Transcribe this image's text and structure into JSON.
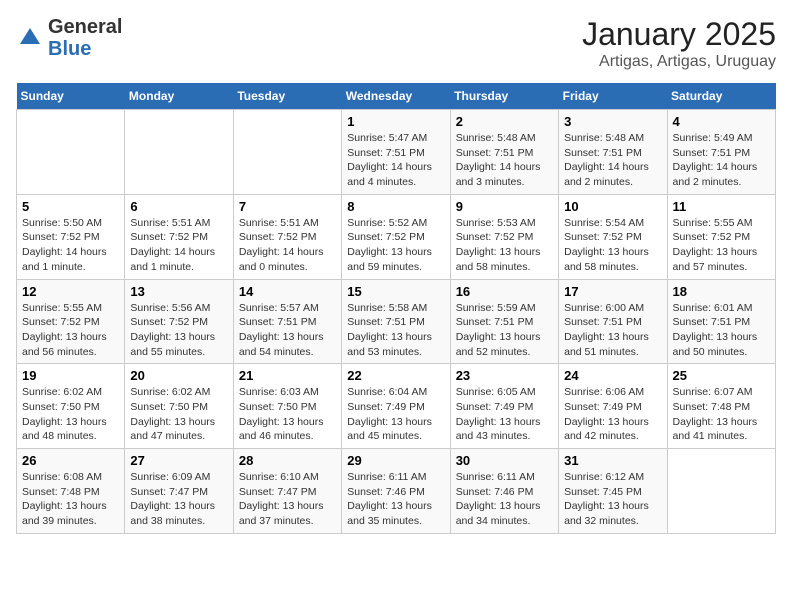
{
  "logo": {
    "general": "General",
    "blue": "Blue"
  },
  "title": "January 2025",
  "subtitle": "Artigas, Artigas, Uruguay",
  "days_of_week": [
    "Sunday",
    "Monday",
    "Tuesday",
    "Wednesday",
    "Thursday",
    "Friday",
    "Saturday"
  ],
  "weeks": [
    [
      {
        "day": "",
        "info": ""
      },
      {
        "day": "",
        "info": ""
      },
      {
        "day": "",
        "info": ""
      },
      {
        "day": "1",
        "info": "Sunrise: 5:47 AM\nSunset: 7:51 PM\nDaylight: 14 hours\nand 4 minutes."
      },
      {
        "day": "2",
        "info": "Sunrise: 5:48 AM\nSunset: 7:51 PM\nDaylight: 14 hours\nand 3 minutes."
      },
      {
        "day": "3",
        "info": "Sunrise: 5:48 AM\nSunset: 7:51 PM\nDaylight: 14 hours\nand 2 minutes."
      },
      {
        "day": "4",
        "info": "Sunrise: 5:49 AM\nSunset: 7:51 PM\nDaylight: 14 hours\nand 2 minutes."
      }
    ],
    [
      {
        "day": "5",
        "info": "Sunrise: 5:50 AM\nSunset: 7:52 PM\nDaylight: 14 hours\nand 1 minute."
      },
      {
        "day": "6",
        "info": "Sunrise: 5:51 AM\nSunset: 7:52 PM\nDaylight: 14 hours\nand 1 minute."
      },
      {
        "day": "7",
        "info": "Sunrise: 5:51 AM\nSunset: 7:52 PM\nDaylight: 14 hours\nand 0 minutes."
      },
      {
        "day": "8",
        "info": "Sunrise: 5:52 AM\nSunset: 7:52 PM\nDaylight: 13 hours\nand 59 minutes."
      },
      {
        "day": "9",
        "info": "Sunrise: 5:53 AM\nSunset: 7:52 PM\nDaylight: 13 hours\nand 58 minutes."
      },
      {
        "day": "10",
        "info": "Sunrise: 5:54 AM\nSunset: 7:52 PM\nDaylight: 13 hours\nand 58 minutes."
      },
      {
        "day": "11",
        "info": "Sunrise: 5:55 AM\nSunset: 7:52 PM\nDaylight: 13 hours\nand 57 minutes."
      }
    ],
    [
      {
        "day": "12",
        "info": "Sunrise: 5:55 AM\nSunset: 7:52 PM\nDaylight: 13 hours\nand 56 minutes."
      },
      {
        "day": "13",
        "info": "Sunrise: 5:56 AM\nSunset: 7:52 PM\nDaylight: 13 hours\nand 55 minutes."
      },
      {
        "day": "14",
        "info": "Sunrise: 5:57 AM\nSunset: 7:51 PM\nDaylight: 13 hours\nand 54 minutes."
      },
      {
        "day": "15",
        "info": "Sunrise: 5:58 AM\nSunset: 7:51 PM\nDaylight: 13 hours\nand 53 minutes."
      },
      {
        "day": "16",
        "info": "Sunrise: 5:59 AM\nSunset: 7:51 PM\nDaylight: 13 hours\nand 52 minutes."
      },
      {
        "day": "17",
        "info": "Sunrise: 6:00 AM\nSunset: 7:51 PM\nDaylight: 13 hours\nand 51 minutes."
      },
      {
        "day": "18",
        "info": "Sunrise: 6:01 AM\nSunset: 7:51 PM\nDaylight: 13 hours\nand 50 minutes."
      }
    ],
    [
      {
        "day": "19",
        "info": "Sunrise: 6:02 AM\nSunset: 7:50 PM\nDaylight: 13 hours\nand 48 minutes."
      },
      {
        "day": "20",
        "info": "Sunrise: 6:02 AM\nSunset: 7:50 PM\nDaylight: 13 hours\nand 47 minutes."
      },
      {
        "day": "21",
        "info": "Sunrise: 6:03 AM\nSunset: 7:50 PM\nDaylight: 13 hours\nand 46 minutes."
      },
      {
        "day": "22",
        "info": "Sunrise: 6:04 AM\nSunset: 7:49 PM\nDaylight: 13 hours\nand 45 minutes."
      },
      {
        "day": "23",
        "info": "Sunrise: 6:05 AM\nSunset: 7:49 PM\nDaylight: 13 hours\nand 43 minutes."
      },
      {
        "day": "24",
        "info": "Sunrise: 6:06 AM\nSunset: 7:49 PM\nDaylight: 13 hours\nand 42 minutes."
      },
      {
        "day": "25",
        "info": "Sunrise: 6:07 AM\nSunset: 7:48 PM\nDaylight: 13 hours\nand 41 minutes."
      }
    ],
    [
      {
        "day": "26",
        "info": "Sunrise: 6:08 AM\nSunset: 7:48 PM\nDaylight: 13 hours\nand 39 minutes."
      },
      {
        "day": "27",
        "info": "Sunrise: 6:09 AM\nSunset: 7:47 PM\nDaylight: 13 hours\nand 38 minutes."
      },
      {
        "day": "28",
        "info": "Sunrise: 6:10 AM\nSunset: 7:47 PM\nDaylight: 13 hours\nand 37 minutes."
      },
      {
        "day": "29",
        "info": "Sunrise: 6:11 AM\nSunset: 7:46 PM\nDaylight: 13 hours\nand 35 minutes."
      },
      {
        "day": "30",
        "info": "Sunrise: 6:11 AM\nSunset: 7:46 PM\nDaylight: 13 hours\nand 34 minutes."
      },
      {
        "day": "31",
        "info": "Sunrise: 6:12 AM\nSunset: 7:45 PM\nDaylight: 13 hours\nand 32 minutes."
      },
      {
        "day": "",
        "info": ""
      }
    ]
  ]
}
